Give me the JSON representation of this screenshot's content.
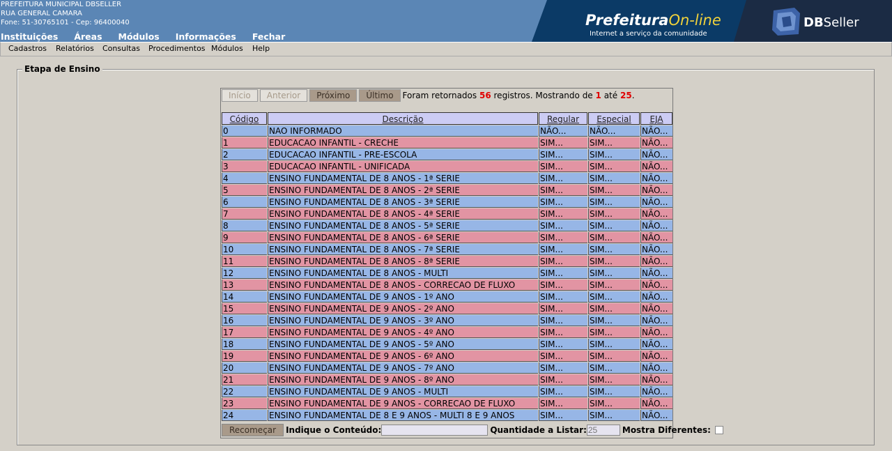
{
  "header": {
    "org_lines": [
      "PREFEITURA MUNICIPAL DBSELLER",
      "RUA GENERAL CAMARA",
      "Fone: 51-30765101  -  Cep: 96400040"
    ],
    "nav": [
      "Instituições",
      "Áreas",
      "Módulos",
      "Informações",
      "Fechar"
    ],
    "banner_title_a": "Prefeitura",
    "banner_title_b": "On-line",
    "banner_subtitle": "Internet a serviço da comunidade",
    "brand_db": "DB",
    "brand_seller": "Seller"
  },
  "submenu": [
    "Cadastros",
    "Relatórios",
    "Consultas",
    "Procedimentos",
    "Módulos",
    "Help"
  ],
  "panel": {
    "legend": "Etapa de Ensino"
  },
  "pager": {
    "first": "Início",
    "prev": "Anterior",
    "next": "Próximo",
    "last": "Último",
    "info_a": "Foram retornados",
    "total": "56",
    "info_b": "registros. Mostrando de",
    "from": "1",
    "info_c": "até",
    "to": "25",
    "info_d": "."
  },
  "table": {
    "columns": [
      "Código",
      "Descrição",
      "Regular",
      "Especial",
      "EJA"
    ],
    "rows": [
      [
        "0",
        "NAO INFORMADO",
        "NÃO...",
        "NÃO...",
        "NÃO..."
      ],
      [
        "1",
        "EDUCACAO INFANTIL - CRECHE",
        "SIM...",
        "SIM...",
        "NÃO..."
      ],
      [
        "2",
        "EDUCACAO INFANTIL - PRE-ESCOLA",
        "SIM...",
        "SIM...",
        "NÃO..."
      ],
      [
        "3",
        "EDUCACAO INFANTIL - UNIFICADA",
        "SIM...",
        "SIM...",
        "NÃO..."
      ],
      [
        "4",
        "ENSINO FUNDAMENTAL DE 8 ANOS - 1ª SERIE",
        "SIM...",
        "SIM...",
        "NÃO..."
      ],
      [
        "5",
        "ENSINO FUNDAMENTAL DE 8 ANOS - 2ª SERIE",
        "SIM...",
        "SIM...",
        "NÃO..."
      ],
      [
        "6",
        "ENSINO FUNDAMENTAL DE 8 ANOS - 3ª SERIE",
        "SIM...",
        "SIM...",
        "NÃO..."
      ],
      [
        "7",
        "ENSINO FUNDAMENTAL DE 8 ANOS - 4ª SERIE",
        "SIM...",
        "SIM...",
        "NÃO..."
      ],
      [
        "8",
        "ENSINO FUNDAMENTAL DE 8 ANOS - 5ª SERIE",
        "SIM...",
        "SIM...",
        "NÃO..."
      ],
      [
        "9",
        "ENSINO FUNDAMENTAL DE 8 ANOS - 6ª SERIE",
        "SIM...",
        "SIM...",
        "NÃO..."
      ],
      [
        "10",
        "ENSINO FUNDAMENTAL DE 8 ANOS - 7ª SERIE",
        "SIM...",
        "SIM...",
        "NÃO..."
      ],
      [
        "11",
        "ENSINO FUNDAMENTAL DE 8 ANOS - 8ª SERIE",
        "SIM...",
        "SIM...",
        "NÃO..."
      ],
      [
        "12",
        "ENSINO FUNDAMENTAL DE 8 ANOS - MULTI",
        "SIM...",
        "SIM...",
        "NÃO..."
      ],
      [
        "13",
        "ENSINO FUNDAMENTAL DE 8 ANOS - CORRECAO DE FLUXO",
        "SIM...",
        "SIM...",
        "NÃO..."
      ],
      [
        "14",
        "ENSINO FUNDAMENTAL DE 9 ANOS - 1º ANO",
        "SIM...",
        "SIM...",
        "NÃO..."
      ],
      [
        "15",
        "ENSINO FUNDAMENTAL DE 9 ANOS - 2º ANO",
        "SIM...",
        "SIM...",
        "NÃO..."
      ],
      [
        "16",
        "ENSINO FUNDAMENTAL DE 9 ANOS - 3º ANO",
        "SIM...",
        "SIM...",
        "NÃO..."
      ],
      [
        "17",
        "ENSINO FUNDAMENTAL DE 9 ANOS - 4º ANO",
        "SIM...",
        "SIM...",
        "NÃO..."
      ],
      [
        "18",
        "ENSINO FUNDAMENTAL DE 9 ANOS - 5º ANO",
        "SIM...",
        "SIM...",
        "NÃO..."
      ],
      [
        "19",
        "ENSINO FUNDAMENTAL DE 9 ANOS - 6º ANO",
        "SIM...",
        "SIM...",
        "NÃO..."
      ],
      [
        "20",
        "ENSINO FUNDAMENTAL DE 9 ANOS - 7º ANO",
        "SIM...",
        "SIM...",
        "NÃO..."
      ],
      [
        "21",
        "ENSINO FUNDAMENTAL DE 9 ANOS - 8º ANO",
        "SIM...",
        "SIM...",
        "NÃO..."
      ],
      [
        "22",
        "ENSINO FUNDAMENTAL DE 9 ANOS - MULTI",
        "SIM...",
        "SIM...",
        "NÃO..."
      ],
      [
        "23",
        "ENSINO FUNDAMENTAL DE 9 ANOS - CORRECAO DE FLUXO",
        "SIM...",
        "SIM...",
        "NÃO..."
      ],
      [
        "24",
        "ENSINO FUNDAMENTAL DE 8 E 9 ANOS - MULTI 8 E 9 ANOS",
        "SIM...",
        "SIM...",
        "NÃO..."
      ]
    ]
  },
  "footer": {
    "restart": "Recomeçar",
    "content_label": "Indique o Conteúdo:",
    "content_value": "",
    "qty_label": "Quantidade a Listar:",
    "qty_value": "25",
    "diff_label": "Mostra Diferentes:"
  },
  "colors": {
    "row_a": "#97b6e6",
    "row_b": "#e294a3",
    "header_blue": "#5b86b5"
  }
}
